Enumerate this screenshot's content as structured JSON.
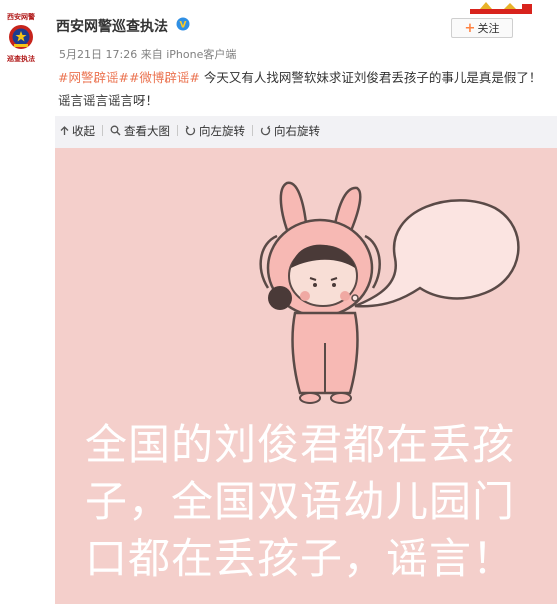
{
  "author": {
    "name": "西安网警巡查执法",
    "avatar_top_text": "西安网警",
    "avatar_bottom_text": "巡查执法",
    "verified_icon": "verified-badge-icon"
  },
  "follow_button": {
    "label": "关注"
  },
  "meta": {
    "date": "5月21日 17:26",
    "source_prefix": "来自",
    "source": "iPhone客户端"
  },
  "post": {
    "tags": [
      "#网警辟谣#",
      "#微博辟谣#"
    ],
    "text": " 今天又有人找网警软妹求证刘俊君丢孩子的事儿是真是假了！谣言谣言谣言呀！"
  },
  "toolbar": {
    "collapse": "收起",
    "view_large": "查看大图",
    "rotate_left": "向左旋转",
    "rotate_right": "向右旋转"
  },
  "image": {
    "caption": "全国的刘俊君都在丢孩子，全国双语幼儿园门口都在丢孩子，谣言！",
    "colors": {
      "background": "#f4cfcb",
      "character": "#f7b9b4",
      "outline": "#5a4a47"
    }
  },
  "colors": {
    "tag": "#eb7350",
    "meta": "#808080",
    "accent": "#ff8140"
  }
}
